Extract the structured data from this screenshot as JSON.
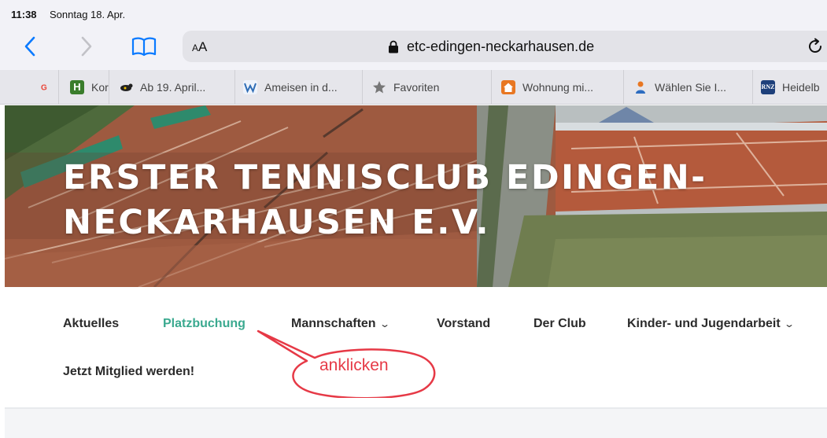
{
  "status": {
    "time": "11:38",
    "date": "Sonntag 18. Apr."
  },
  "browser": {
    "text_size_label": "AA",
    "url": "etc-edingen-neckarhausen.de",
    "favorites": [
      {
        "label": "",
        "icon": "google-icon",
        "color": "#4285f4"
      },
      {
        "label": "Kor",
        "icon": "h-icon",
        "color": "#3a7d2c"
      },
      {
        "label": "Ab 19. April...",
        "icon": "animal-icon",
        "color": "#222222"
      },
      {
        "label": "Ameisen in d...",
        "icon": "w-icon",
        "color": "#2f6db5"
      },
      {
        "label": "Favoriten",
        "icon": "star-icon",
        "color": "#777777"
      },
      {
        "label": "Wohnung mi...",
        "icon": "house-icon",
        "color": "#e87722"
      },
      {
        "label": "Wählen Sie I...",
        "icon": "person-icon",
        "color": "#2d6cc0"
      },
      {
        "label": "Heidelb",
        "icon": "rnz-icon",
        "color": "#1d3f7a"
      }
    ]
  },
  "hero": {
    "title": "ERSTER TENNISCLUB EDINGEN-NECKARHAUSEN E.V."
  },
  "nav": {
    "items": [
      {
        "label": "Aktuelles"
      },
      {
        "label": "Platzbuchung"
      },
      {
        "label": "Mannschaften"
      },
      {
        "label": "Vorstand"
      },
      {
        "label": "Der Club"
      },
      {
        "label": "Kinder- und Jugendarbeit"
      },
      {
        "label": "Jetzt Mitglied werden!"
      }
    ]
  },
  "annotation": {
    "text": "anklicken",
    "color": "#e63946"
  },
  "colors": {
    "accent": "#3aa98f",
    "ios_blue": "#0a7aff"
  }
}
